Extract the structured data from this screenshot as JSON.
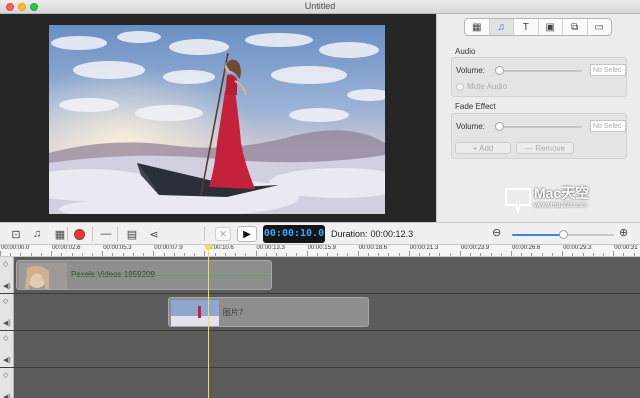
{
  "window": {
    "title": "Untitled"
  },
  "panel_tabs": [
    {
      "icon": "film-icon",
      "glyph": "▦"
    },
    {
      "icon": "music-note-icon",
      "glyph": "♫",
      "active": true
    },
    {
      "icon": "text-icon",
      "glyph": "T"
    },
    {
      "icon": "filter-icon",
      "glyph": "▣"
    },
    {
      "icon": "shapes-icon",
      "glyph": "⧉"
    },
    {
      "icon": "folder-icon",
      "glyph": "▭"
    }
  ],
  "audio": {
    "title": "Audio",
    "volume_label": "Volume:",
    "volume_value": 0,
    "volume_placeholder": "No Selec",
    "mute_label": "Mute Audio"
  },
  "fade": {
    "title": "Fade Effect",
    "volume_label": "Volume:",
    "volume_value": 0,
    "volume_placeholder": "No Selec",
    "add_label": "+ Add",
    "remove_label": "— Remove"
  },
  "toolbar": {
    "tools": [
      {
        "icon": "screenshot-icon",
        "glyph": "⊡"
      },
      {
        "icon": "music-icon",
        "glyph": "♫"
      },
      {
        "icon": "film-strip-icon",
        "glyph": "▦"
      },
      {
        "icon": "record-icon",
        "glyph": ""
      },
      {
        "icon": "dash-icon",
        "glyph": "—"
      },
      {
        "icon": "grid-icon",
        "glyph": "▤"
      },
      {
        "icon": "share-icon",
        "glyph": "⋖"
      }
    ],
    "split_glyph": "✕",
    "play_glyph": "▶",
    "timecode": "00:00:10.0",
    "duration_label": "Duration:",
    "duration_value": "00:00:12.3",
    "zoom_out_glyph": "⊖",
    "zoom_in_glyph": "⊕",
    "zoom_level": 0.5
  },
  "ruler": {
    "labels": [
      "00:00:00.0",
      "00:00:02.6",
      "00:00:05.3",
      "00:00:07.9",
      "00:00:10.6",
      "00:00:13.3",
      "00:00:15.9",
      "00:00:18.6",
      "00:00:21.3",
      "00:00:23.9",
      "00:00:26.6",
      "00:00:29.3",
      "00:00:31"
    ]
  },
  "playhead_time": "00:00:10.0",
  "tracks": [
    {
      "clips": [
        {
          "label": "Pexels Videos 1959209",
          "kind": "video",
          "start": 0.0,
          "end": 13.3
        }
      ]
    },
    {
      "clips": [
        {
          "label": "图片7",
          "kind": "image",
          "start": 7.9,
          "end": 18.4
        }
      ]
    },
    {
      "clips": []
    },
    {
      "clips": []
    }
  ],
  "watermark": {
    "big": "Mac天空",
    "small": "www.mac69.com"
  },
  "colors": {
    "accent": "#36a9ff",
    "playhead": "#f0e14a",
    "record": "#e23a3a",
    "dress": "#c4223a"
  }
}
